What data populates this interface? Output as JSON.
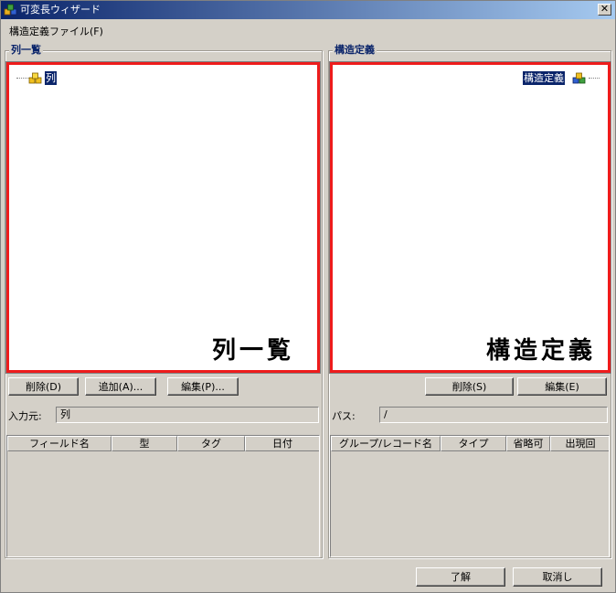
{
  "window": {
    "title": "可変長ウィザード",
    "close_glyph": "✕"
  },
  "menu": {
    "items": [
      {
        "label": "構造定義ファイル(F)"
      }
    ]
  },
  "left_panel": {
    "group_label": "列一覧",
    "tree_root_label": "列",
    "caption": "列一覧",
    "buttons": {
      "delete": "削除(D)",
      "add": "追加(A)...",
      "edit": "編集(P)..."
    },
    "input_label": "入力元:",
    "input_value": "列",
    "columns": [
      "フィールド名",
      "型",
      "タグ",
      "日付"
    ]
  },
  "right_panel": {
    "group_label": "構造定義",
    "tree_root_label": "構造定義",
    "caption": "構造定義",
    "buttons": {
      "delete": "削除(S)",
      "edit": "編集(E)"
    },
    "path_label": "パス:",
    "path_value": "/",
    "columns": [
      "グループ/レコード名",
      "タイプ",
      "省略可",
      "出現回"
    ]
  },
  "footer": {
    "ok": "了解",
    "cancel": "取消し"
  },
  "colors": {
    "highlight": "#0a246a",
    "annotation_border": "#ee1c1c",
    "face": "#d4d0c8"
  },
  "icons": {
    "app": "wizard-cubes-icon",
    "columns_node": "yellow-cubes-icon",
    "structure_node": "blue-cubes-icon"
  }
}
